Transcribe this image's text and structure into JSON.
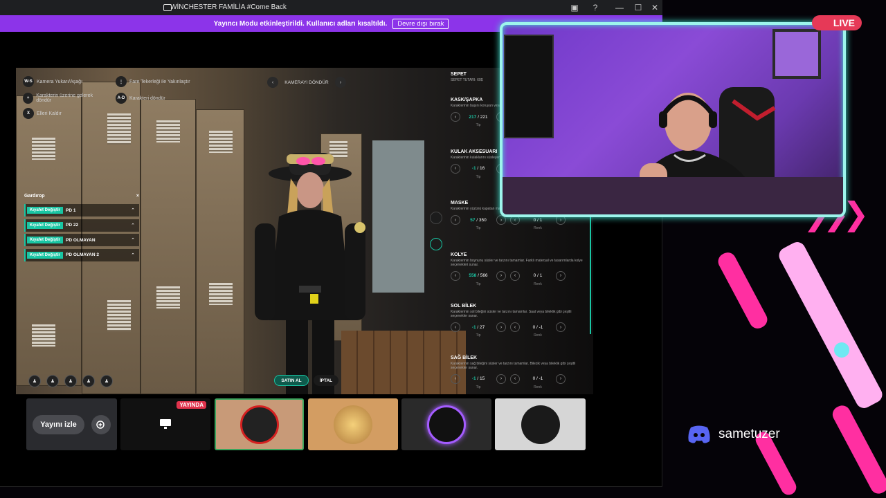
{
  "titlebar": {
    "title": "WİNCHESTER FAMİLİA #Come Back",
    "btn_min": "—",
    "btn_max": "☐",
    "btn_close": "✕",
    "btn_help": "?",
    "btn_screen": "▣"
  },
  "notice": {
    "text": "Yayıncı Modu etkinleştirildi. Kullanıcı adları kısaltıldı.",
    "button": "Devre dışı bırak"
  },
  "game": {
    "hud": [
      {
        "key": "W-S",
        "label": "Kamera Yukarı/Aşağı"
      },
      {
        "key": "+",
        "label": "Karakterin üzerine gelerek döndür"
      },
      {
        "key": "X",
        "label": "Elleri Kaldır"
      },
      {
        "key": "A-D",
        "label": "Karakteri döndür"
      },
      {
        "key": "⋮",
        "label": "Fare Tekerleği ile Yakınlaştır"
      }
    ],
    "camera_label": "KAMERAYI DÖNDÜR",
    "wardrobe": {
      "title": "Gardırop",
      "close": "×",
      "items": [
        {
          "tag": "Kıyafet Değiştir",
          "name": "PD 1"
        },
        {
          "tag": "Kıyafet Değiştir",
          "name": "PD 22"
        },
        {
          "tag": "Kıyafet Değiştir",
          "name": "PD OLMAYAN"
        },
        {
          "tag": "Kıyafet Değiştir",
          "name": "PD OLMAYAN 2"
        }
      ]
    },
    "shop": {
      "title": "SEPET",
      "total": "SEPET TUTARI: 60$",
      "sections": [
        {
          "name": "KASK/ŞAPKA",
          "desc": "Karakterinin başını koruyan veya kask seçenekleri sunar.",
          "type_val": "217",
          "type_max": "/ 221",
          "type_lbl": "Tip",
          "tex_val": "",
          "tex_lbl": ""
        },
        {
          "name": "KULAK AKSESUARI",
          "desc": "Karakterinin kulaklarını süsleyen küpe gibi çeşitli seçenekler.",
          "type_val": "-1",
          "type_max": "/ 16",
          "type_lbl": "Tip",
          "tex_val": "",
          "tex_lbl": ""
        },
        {
          "name": "MASKE",
          "desc": "Karakterinin yüzünü kapatan maske seçenekleri sunar.",
          "type_val": "57",
          "type_max": "/ 350",
          "type_lbl": "Tip",
          "tex_val": "0 / 1",
          "tex_lbl": "Renk"
        },
        {
          "name": "KOLYE",
          "desc": "Karakterinin boynunu süsler ve tarzını tamamlar. Farklı materyal ve tasarımlarda kolye seçenekleri sunar.",
          "type_val": "558",
          "type_max": "/ 566",
          "type_lbl": "Tip",
          "tex_val": "0 / 1",
          "tex_lbl": "Renk"
        },
        {
          "name": "SOL BİLEK",
          "desc": "Karakterinin sol bileğini süsler ve tarzını tamamlar. Saat veya bileklik gibi çeşitli seçenekler sunar.",
          "type_val": "-1",
          "type_max": "/ 27",
          "type_lbl": "Tip",
          "tex_val": "0 / -1",
          "tex_lbl": "Renk"
        },
        {
          "name": "SAĞ BİLEK",
          "desc": "Karakterinin sağ bileğini süsler ve tarzını tamamlar. Bilezik veya bileklik gibi çeşitli seçenekler sunar.",
          "type_val": "-1",
          "type_max": "/ 15",
          "type_lbl": "Tip",
          "tex_val": "0 / -1",
          "tex_lbl": "Renk"
        }
      ]
    },
    "buy": "SATIN AL",
    "cancel": "İPTAL"
  },
  "thumbs": {
    "watch": "Yayını izle",
    "live": "YAYINDA"
  },
  "overlay": {
    "live": "LIVE",
    "discord": "sametuzer"
  },
  "colors": {
    "accent": "#19c5a3",
    "purple": "#8c34e9",
    "pink": "#ff3fa4",
    "teal": "#43e9d6"
  },
  "icons": [
    "app-logo-icon",
    "screen-icon",
    "help-icon",
    "monitor-icon",
    "add-stream-icon",
    "discord-icon"
  ]
}
